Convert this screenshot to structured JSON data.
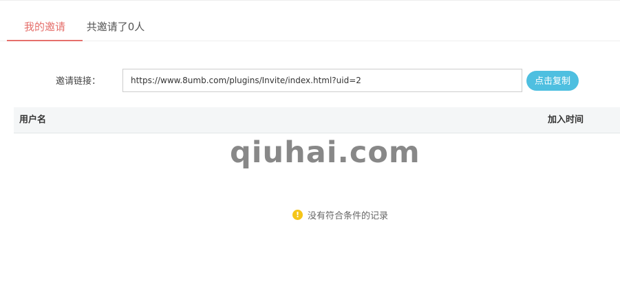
{
  "tabs": {
    "my_invites": "我的邀请",
    "invited_count": "共邀请了0人"
  },
  "invite": {
    "label": "邀请链接：",
    "link": "https://www.8umb.com/plugins/Invite/index.html?uid=2",
    "copy_label": "点击复制"
  },
  "table": {
    "columns": [
      "用户名",
      "加入时间"
    ],
    "rows": []
  },
  "watermark": "qiuhai.com",
  "empty_state": {
    "icon": "exclamation-circle-icon",
    "icon_glyph": "!",
    "icon_color": "#f5c518",
    "text": "没有符合条件的记录"
  },
  "colors": {
    "accent": "#e56f6b",
    "button": "#4ebfe0"
  }
}
